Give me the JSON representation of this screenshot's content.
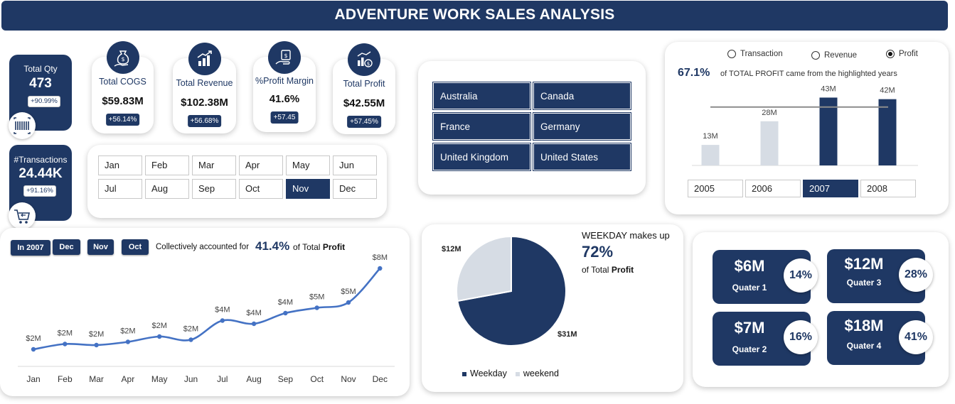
{
  "title": "ADVENTURE WORK SALES ANALYSIS",
  "side_kpis": {
    "qty": {
      "label": "Total Qty",
      "value": "473",
      "change": "+90.99%"
    },
    "transactions": {
      "label": "#Transactions",
      "value": "24.44K",
      "change": "+91.16%"
    }
  },
  "kpis": [
    {
      "label": "Total COGS",
      "value": "$59.83M",
      "change": "+56.14%"
    },
    {
      "label": "Total Revenue",
      "value": "$102.38M",
      "change": "+56.68%"
    },
    {
      "label": "%Profit Margin",
      "value": "41.6%",
      "change": "+57.45"
    },
    {
      "label": "Total Profit",
      "value": "$42.55M",
      "change": "+57.45%"
    }
  ],
  "months": [
    "Jan",
    "Feb",
    "Mar",
    "Apr",
    "May",
    "Jun",
    "Jul",
    "Aug",
    "Sep",
    "Oct",
    "Nov",
    "Dec"
  ],
  "selected_month": "Nov",
  "countries": [
    "Australia",
    "Canada",
    "France",
    "Germany",
    "United Kingdom",
    "United States"
  ],
  "year_panel": {
    "radios": [
      "Transaction",
      "Revenue",
      "Profit"
    ],
    "selected_radio": "Profit",
    "pct": "67.1%",
    "caption": "of TOTAL PROFIT came from the highlighted years",
    "years": [
      "2005",
      "2006",
      "2007",
      "2008"
    ],
    "selected_year": "2007"
  },
  "trend_panel": {
    "tags": [
      "In 2007",
      "Dec",
      "Nov",
      "Oct"
    ],
    "caption": "Collectively accounted for",
    "pct": "41.4%",
    "suffix": "of Total",
    "suffix_bold": "Profit"
  },
  "pie_panel": {
    "headline": "WEEKDAY makes up",
    "pct": "72%",
    "sub": "of Total",
    "sub_bold": "Profit",
    "legend": [
      "Weekday",
      "weekend"
    ]
  },
  "quarters": [
    {
      "value": "$6M",
      "label": "Quater 1",
      "pct": "14%"
    },
    {
      "value": "$12M",
      "label": "Quater 3",
      "pct": "28%"
    },
    {
      "value": "$7M",
      "label": "Quater 2",
      "pct": "16%"
    },
    {
      "value": "$18M",
      "label": "Quater 4",
      "pct": "41%"
    }
  ],
  "colors": {
    "navy": "#1f3864",
    "bar_light": "#d6dce4",
    "line": "#4472c4",
    "pie_light": "#d6dce4"
  },
  "chart_data": [
    {
      "type": "bar",
      "categories": [
        "2005",
        "2006",
        "2007",
        "2008"
      ],
      "values": [
        13,
        28,
        43,
        42
      ],
      "labels": [
        "13M",
        "28M",
        "43M",
        "42M"
      ],
      "highlighted": [
        "2007",
        "2008"
      ],
      "average_line": 37,
      "ylim": [
        0,
        45
      ]
    },
    {
      "type": "line",
      "categories": [
        "Jan",
        "Feb",
        "Mar",
        "Apr",
        "May",
        "Jun",
        "Jul",
        "Aug",
        "Sep",
        "Oct",
        "Nov",
        "Dec"
      ],
      "values": [
        1.6,
        2.1,
        2.0,
        2.3,
        2.8,
        2.5,
        4.3,
        4.0,
        5.0,
        5.5,
        6.0,
        9.2
      ],
      "labels": [
        "$2M",
        "$2M",
        "$2M",
        "$2M",
        "$2M",
        "$2M",
        "$4M",
        "$4M",
        "$4M",
        "$5M",
        "$5M",
        "$8M"
      ],
      "ylim": [
        0,
        10
      ]
    },
    {
      "type": "pie",
      "categories": [
        "Weekday",
        "weekend"
      ],
      "values": [
        31,
        12
      ],
      "labels": [
        "$31M",
        "$12M"
      ]
    }
  ]
}
